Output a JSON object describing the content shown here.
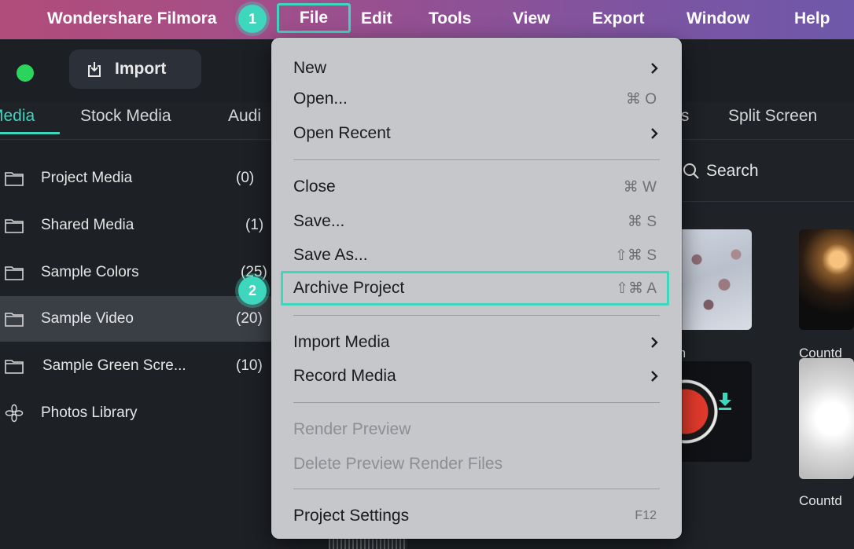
{
  "menubar": {
    "app_name": "Wondershare Filmora",
    "items": [
      "File",
      "Edit",
      "Tools",
      "View",
      "Export",
      "Window",
      "Help"
    ]
  },
  "badges": {
    "step1": "1",
    "step2": "2"
  },
  "toolbar": {
    "import_label": "Import"
  },
  "tabs": {
    "media": "Media",
    "stock_media": "Stock Media",
    "audio": "Audi",
    "effects_fragment": "ts",
    "split_screen": "Split Screen"
  },
  "sidebar": {
    "items": [
      {
        "label": "Project Media",
        "count": "(0)"
      },
      {
        "label": "Shared Media",
        "count": "(1)"
      },
      {
        "label": "Sample Colors",
        "count": "(25)"
      },
      {
        "label": "Sample Video",
        "count": "(20)"
      },
      {
        "label": "Sample Green Scre...",
        "count": "(10)"
      },
      {
        "label": "Photos Library",
        "count": ""
      }
    ]
  },
  "search": {
    "label": "Search"
  },
  "thumbnails": {
    "flowers_label": "m",
    "countdown1_label": "Countd",
    "countdown2_label": "Countd"
  },
  "file_menu": {
    "new": "New",
    "open": "Open...",
    "open_shortcut": "⌘ O",
    "open_recent": "Open Recent",
    "close": "Close",
    "close_shortcut": "⌘ W",
    "save": "Save...",
    "save_shortcut": "⌘ S",
    "save_as": "Save As...",
    "save_as_shortcut": "⇧⌘ S",
    "archive": "Archive Project",
    "archive_shortcut": "⇧⌘ A",
    "import_media": "Import Media",
    "record_media": "Record Media",
    "render_preview": "Render Preview",
    "delete_preview": "Delete Preview Render Files",
    "project_settings": "Project Settings",
    "project_settings_shortcut": "F12"
  },
  "colors": {
    "accent": "#3ed6bd",
    "menu_bg": "#c6c7cb",
    "app_bg": "#1f2227"
  }
}
